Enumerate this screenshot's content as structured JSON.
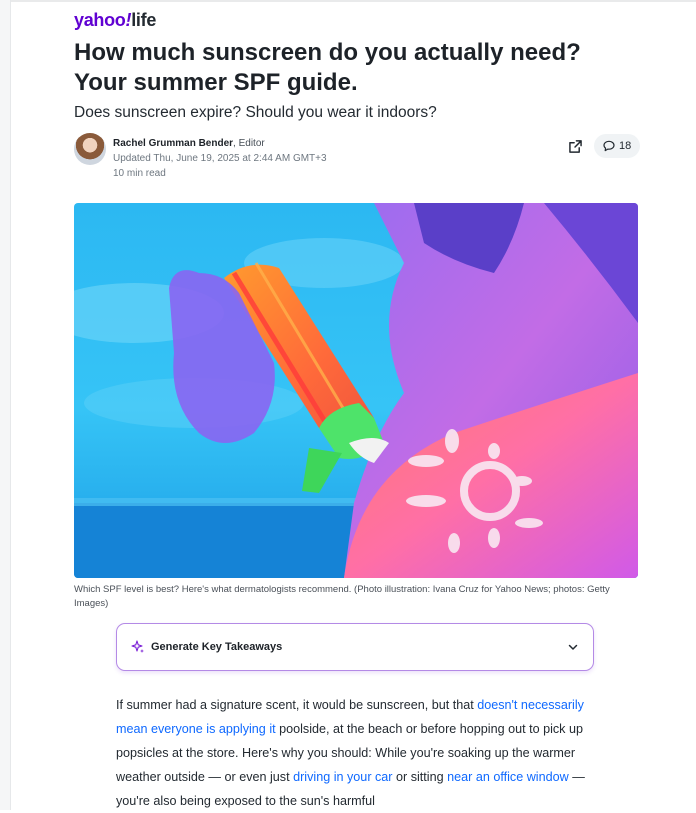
{
  "brand": {
    "name_a": "yahoo",
    "name_b": "!",
    "name_c": "life"
  },
  "article": {
    "title": "How much sunscreen do you actually need? Your summer SPF guide.",
    "subtitle": "Does sunscreen expire? Should you wear it indoors?",
    "author": {
      "name": "Rachel Grumman Bender",
      "role": ", Editor"
    },
    "updated": "Updated Thu, June 19, 2025 at 2:44 AM GMT+3",
    "read_time": "10 min read",
    "comment_count": "18",
    "image_caption": "Which SPF level is best? Here's what dermatologists recommend. (Photo illustration: Ivana Cruz for Yahoo News; photos: Getty Images)"
  },
  "takeaways": {
    "label": "Generate Key Takeaways"
  },
  "body": {
    "p1": "If summer had a signature scent, it would be sunscreen, but that ",
    "link1": "doesn't necessarily mean everyone is applying it",
    "p2": " poolside, at the beach or before hopping out to pick up popsicles at the store. Here's why you should: While you're soaking up the warmer weather outside — or even just ",
    "link2": "driving in your car",
    "p3": " or sitting ",
    "link3": "near an office window",
    "p4": " — you're also being exposed to the sun's harmful"
  },
  "icons": {
    "share": "share-external-icon",
    "comment": "comment-icon",
    "sparkle": "sparkle-icon",
    "chevron": "chevron-down-icon"
  },
  "colors": {
    "brand": "#6001d2",
    "link": "#0f69ff",
    "takeaways_border": "#b48ae6"
  }
}
